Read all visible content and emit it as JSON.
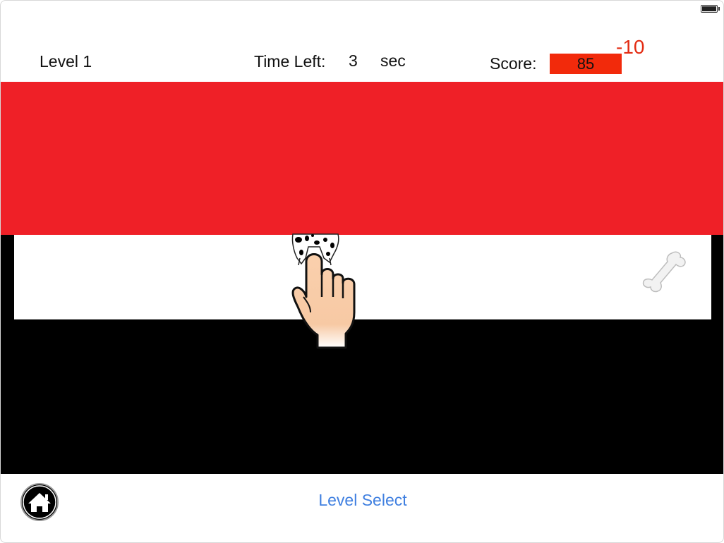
{
  "hud": {
    "level_label": "Level 1",
    "time_label": "Time Left:",
    "time_value": "3",
    "time_unit": "sec",
    "score_label": "Score:",
    "score_value": "85",
    "score_delta": "-10"
  },
  "sprites": {
    "dog": "dalmatian-dog-icon",
    "hand": "pointing-hand-icon",
    "bone": "bone-icon"
  },
  "footer": {
    "home_icon": "home-icon",
    "level_select_label": "Level Select"
  },
  "colors": {
    "score_box": "#f22a0b",
    "score_delta": "#e32b12",
    "red_band": "#ef2027",
    "link": "#3f7fe0"
  }
}
